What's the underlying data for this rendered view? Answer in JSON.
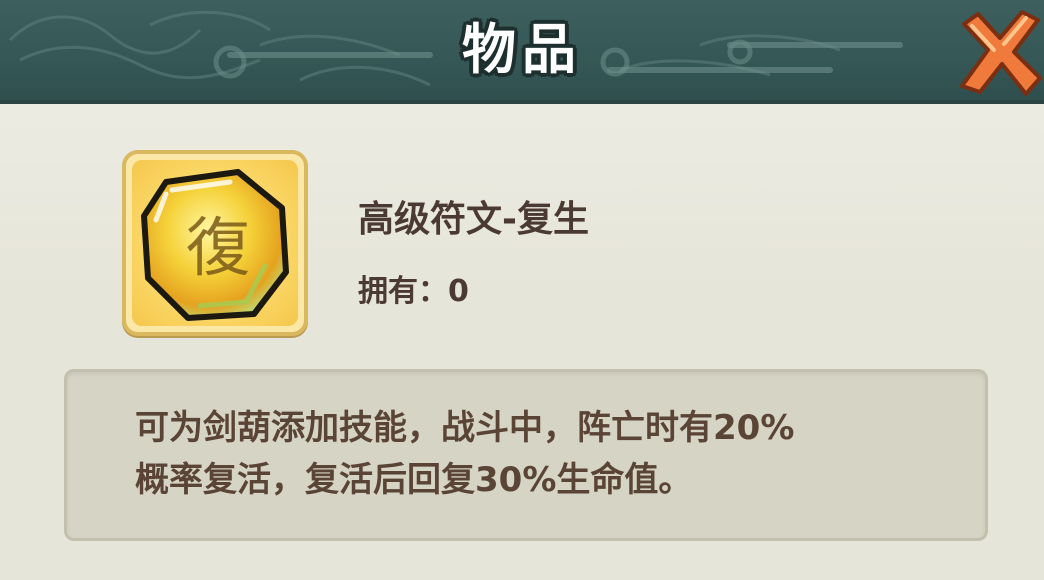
{
  "dialog": {
    "title": "物品"
  },
  "item": {
    "icon": "revive-rune-gem-icon",
    "icon_glyph": "復",
    "name": "高级符文-复生",
    "owned_label": "拥有：",
    "owned_count": "0"
  },
  "description": {
    "line1": "可为剑葫添加技能，战斗中，阵亡时有20%",
    "line2": "概率复活，复活后回复30%生命值。"
  },
  "colors": {
    "header": "#355756",
    "close_icon": "#ef7a3c",
    "text": "#4b3a33",
    "panel": "#e6e5d9",
    "desc_box": "#d6d4c5"
  }
}
